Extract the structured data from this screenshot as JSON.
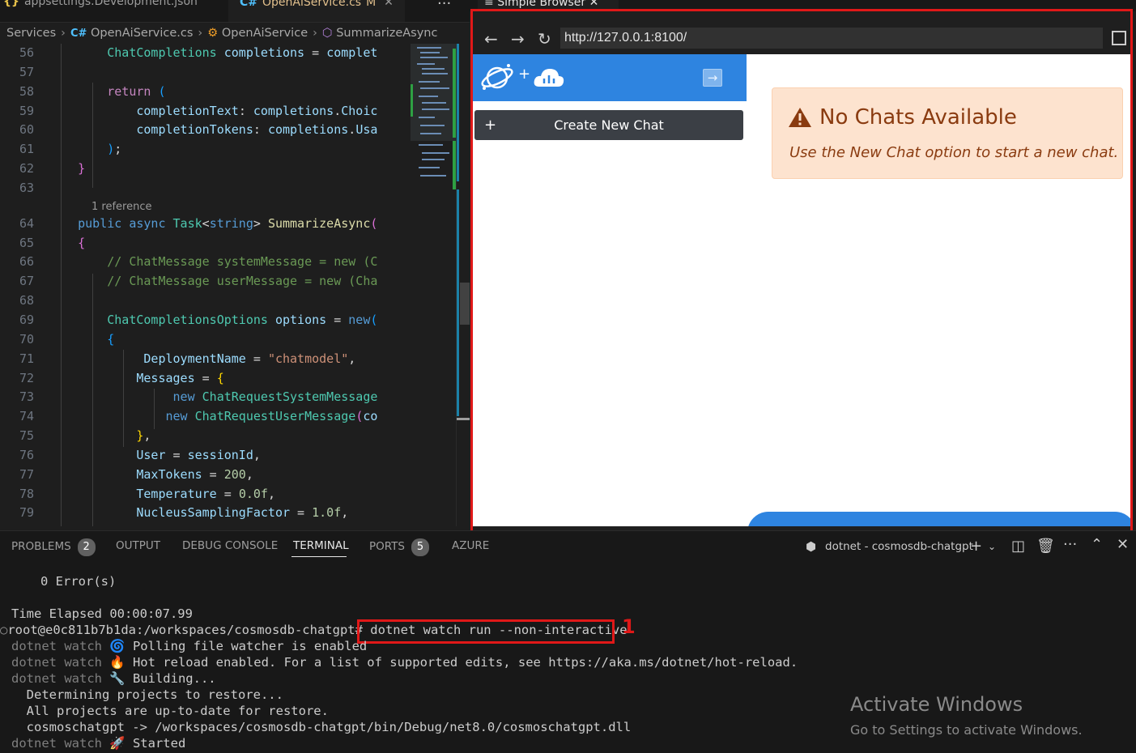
{
  "tabs": [
    {
      "icon": "{}",
      "label": "appsettings.Development.json"
    },
    {
      "icon": "C#",
      "label": "OpenAiService.cs",
      "modified": "M",
      "close": "✕"
    }
  ],
  "editor_more": "···",
  "breadcrumb": {
    "folder": "Services",
    "file": "OpenAiService.cs",
    "class": "OpenAiService",
    "method": "SummarizeAsync"
  },
  "code": {
    "line_numbers": [
      "56",
      "57",
      "58",
      "59",
      "60",
      "61",
      "62",
      "63",
      "64",
      "65",
      "66",
      "67",
      "68",
      "69",
      "70",
      "71",
      "72",
      "73",
      "74",
      "75",
      "76",
      "77",
      "78",
      "79"
    ],
    "reference_hint": "1 reference"
  },
  "browser": {
    "tab_label": "Simple Browser",
    "tab_close": "✕",
    "url": "http://127.0.0.1:8100/",
    "new_chat_label": "Create New Chat",
    "new_chat_plus": "+",
    "logo_plus": "+",
    "collapse_icon": "→",
    "alert_title": "No Chats Available",
    "alert_message": "Use the New Chat option to start a new chat.",
    "colors": {
      "accent": "#2e84e0",
      "alert_bg": "#fde3cf",
      "alert_text": "#8a3b10",
      "annotation": "#e01818"
    }
  },
  "panel": {
    "tabs": [
      {
        "label": "PROBLEMS",
        "badge": "2"
      },
      {
        "label": "OUTPUT"
      },
      {
        "label": "DEBUG CONSOLE"
      },
      {
        "label": "TERMINAL"
      },
      {
        "label": "PORTS",
        "badge": "5"
      },
      {
        "label": "AZURE"
      }
    ],
    "terminal_name": "dotnet - cosmosdb-chatgpt"
  },
  "terminal": {
    "errors": "0 Error(s)",
    "elapsed": "Time Elapsed 00:00:07.99",
    "prompt": "root@e0c811b7b1da:/workspaces/cosmosdb-chatgpt#",
    "command": "dotnet watch run --non-interactive",
    "annotation_number": "1",
    "watch_prefix": "dotnet watch",
    "watch1": "🌀 Polling file watcher is enabled",
    "watch2": "🔥 Hot reload enabled. For a list of supported edits, see https://aka.ms/dotnet/hot-reload.",
    "watch3": "🔧 Building...",
    "restore1": "  Determining projects to restore...",
    "restore2": "  All projects are up-to-date for restore.",
    "output_dll": "  cosmoschatgpt -> /workspaces/cosmosdb-chatgpt/bin/Debug/net8.0/cosmoschatgpt.dll",
    "watch4": "🚀 Started"
  },
  "watermark": {
    "title": "Activate Windows",
    "subtitle": "Go to Settings to activate Windows."
  }
}
